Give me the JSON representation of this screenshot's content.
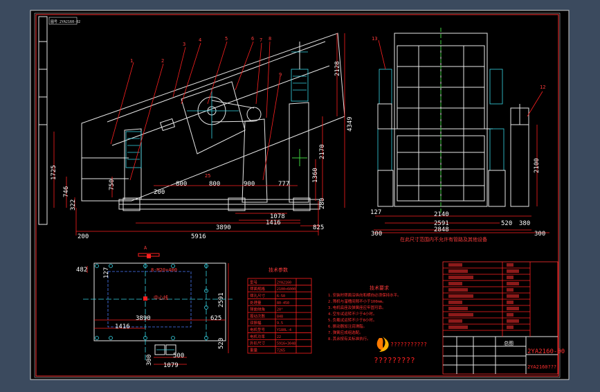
{
  "drawing_no": "2YA2160-00",
  "drawing_no_2": "2YA2160???",
  "title_block_name": "总图",
  "company_text": "?????????",
  "logo_text": "???????????",
  "corner_tag": "图号 2YA2160-02",
  "side_dims": {
    "top": "2128",
    "height_right": "4349",
    "d2170": "2170",
    "d1360": "1360",
    "d1725": "1725",
    "d746": "746",
    "d322": "322",
    "d750": "750",
    "d280": "280",
    "d200": "200",
    "d800a": "800",
    "d800b": "800",
    "d900": "900",
    "d777": "777",
    "d1078": "1078",
    "d1416": "1416",
    "d3890": "3890",
    "d825": "825",
    "d5916": "5916",
    "d200b": "200",
    "d25": "25"
  },
  "end_dims": {
    "d2140": "2140",
    "d2591": "2591",
    "d2848": "2848",
    "d127": "127",
    "d520": "520",
    "d380": "380",
    "d300a": "300",
    "d300b": "300",
    "d2100": "2100",
    "note": "在此尺寸范围内不允许有管路及其他设备"
  },
  "plan_dims": {
    "d482": "482",
    "d127": "127",
    "d3890": "3890",
    "d1416": "1416",
    "d625": "625",
    "d2591": "2591",
    "d520": "520",
    "d500": "500",
    "d300": "300",
    "d1079": "1079",
    "bolt_note": "8-M20×400",
    "center_label": "中心线",
    "view_label": "A"
  },
  "param_table": {
    "title": "技术参数",
    "rows": [
      [
        "型号",
        "2YA2160"
      ],
      [
        "筛面规格",
        "2100×6000"
      ],
      [
        "筛孔尺寸",
        "6-50"
      ],
      [
        "处理量",
        "80-450"
      ],
      [
        "筛面倾角",
        "20°"
      ],
      [
        "振动次数",
        "848"
      ],
      [
        "双振幅",
        "9.5"
      ],
      [
        "电机型号",
        "Y180L-4"
      ],
      [
        "电机功率",
        "22"
      ],
      [
        "外形尺寸",
        "5916×3048"
      ],
      [
        "重量",
        "7265"
      ]
    ]
  },
  "notes": {
    "title": "技术要求",
    "lines": [
      "1.安装时筛面沿纵向和横向必须保持水平。",
      "2.筛机与溜槽间隙不小于100mm。",
      "3.电机底座及弹簧座应牢固可靠。",
      "4.空车试运转不少于4小时。",
      "5.负载试运转不少于8小时。",
      "6.振动器加注润滑脂。",
      "7.弹簧应成组选配。",
      "8.其余按有关标准执行。"
    ]
  },
  "parts": [
    "1",
    "2",
    "3",
    "4",
    "5",
    "6",
    "7",
    "8",
    "9",
    "10",
    "11",
    "12",
    "13"
  ]
}
